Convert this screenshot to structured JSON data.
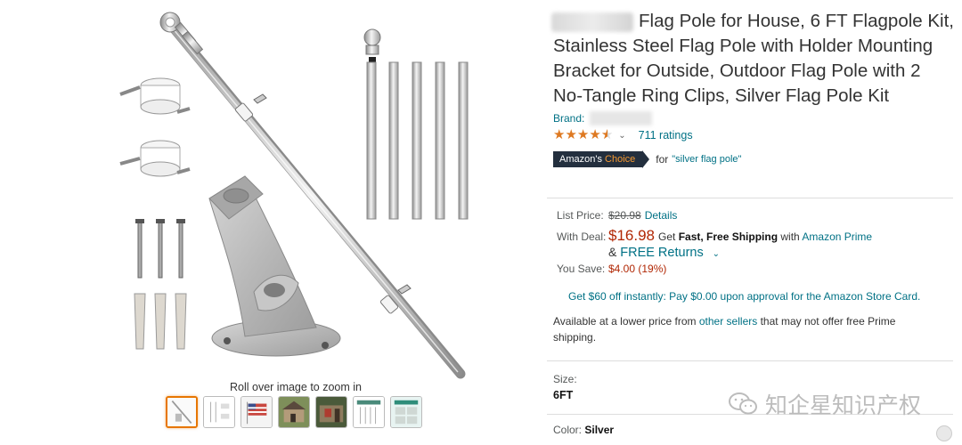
{
  "product": {
    "title": "Flag Pole for House, 6 FT Flagpole Kit, Stainless Steel Flag Pole with Holder Mounting Bracket for Outside, Outdoor Flag Pole with 2 No-Tangle Ring Clips, Silver Flag Pole Kit",
    "brand_label": "Brand:",
    "ratings": "711 ratings",
    "stars": 4.5,
    "badge_prefix": "Amazon's",
    "badge_accent": "Choice",
    "choice_for": "for",
    "choice_keyword": "\"silver flag pole\""
  },
  "gallery": {
    "zoom_hint": "Roll over image to zoom in",
    "thumbnail_icons": [
      "flagpole-photo-icon",
      "parts-diagram-icon",
      "flag-icon",
      "house-photo-icon",
      "porch-photo-icon",
      "size-chart-icon",
      "install-steps-icon"
    ]
  },
  "pricing": {
    "list_label": "List Price:",
    "list_price": "$20.98",
    "details_link": "Details",
    "deal_label": "With Deal:",
    "deal_price": "$16.98",
    "get_text": "Get",
    "shipping_bold": "Fast, Free Shipping",
    "with_text": "with",
    "prime_link": "Amazon Prime",
    "amp": "&",
    "free_returns": "FREE Returns",
    "save_label": "You Save:",
    "savings": "$4.00 (19%)",
    "store_card": "Get $60 off instantly: Pay $0.00 upon approval for the Amazon Store Card."
  },
  "offers": {
    "pre": "Available at a lower price from",
    "link": "other sellers",
    "post": "that may not offer free Prime shipping."
  },
  "options": {
    "size_label": "Size:",
    "size_value": "6FT",
    "color_label": "Color:",
    "color_value": "Silver"
  },
  "watermark": "知企星知识产权",
  "colors": {
    "link": "#007185",
    "price": "#b12704",
    "star": "#de7921",
    "badge_bg": "#232f3e",
    "badge_accent": "#f69931"
  }
}
